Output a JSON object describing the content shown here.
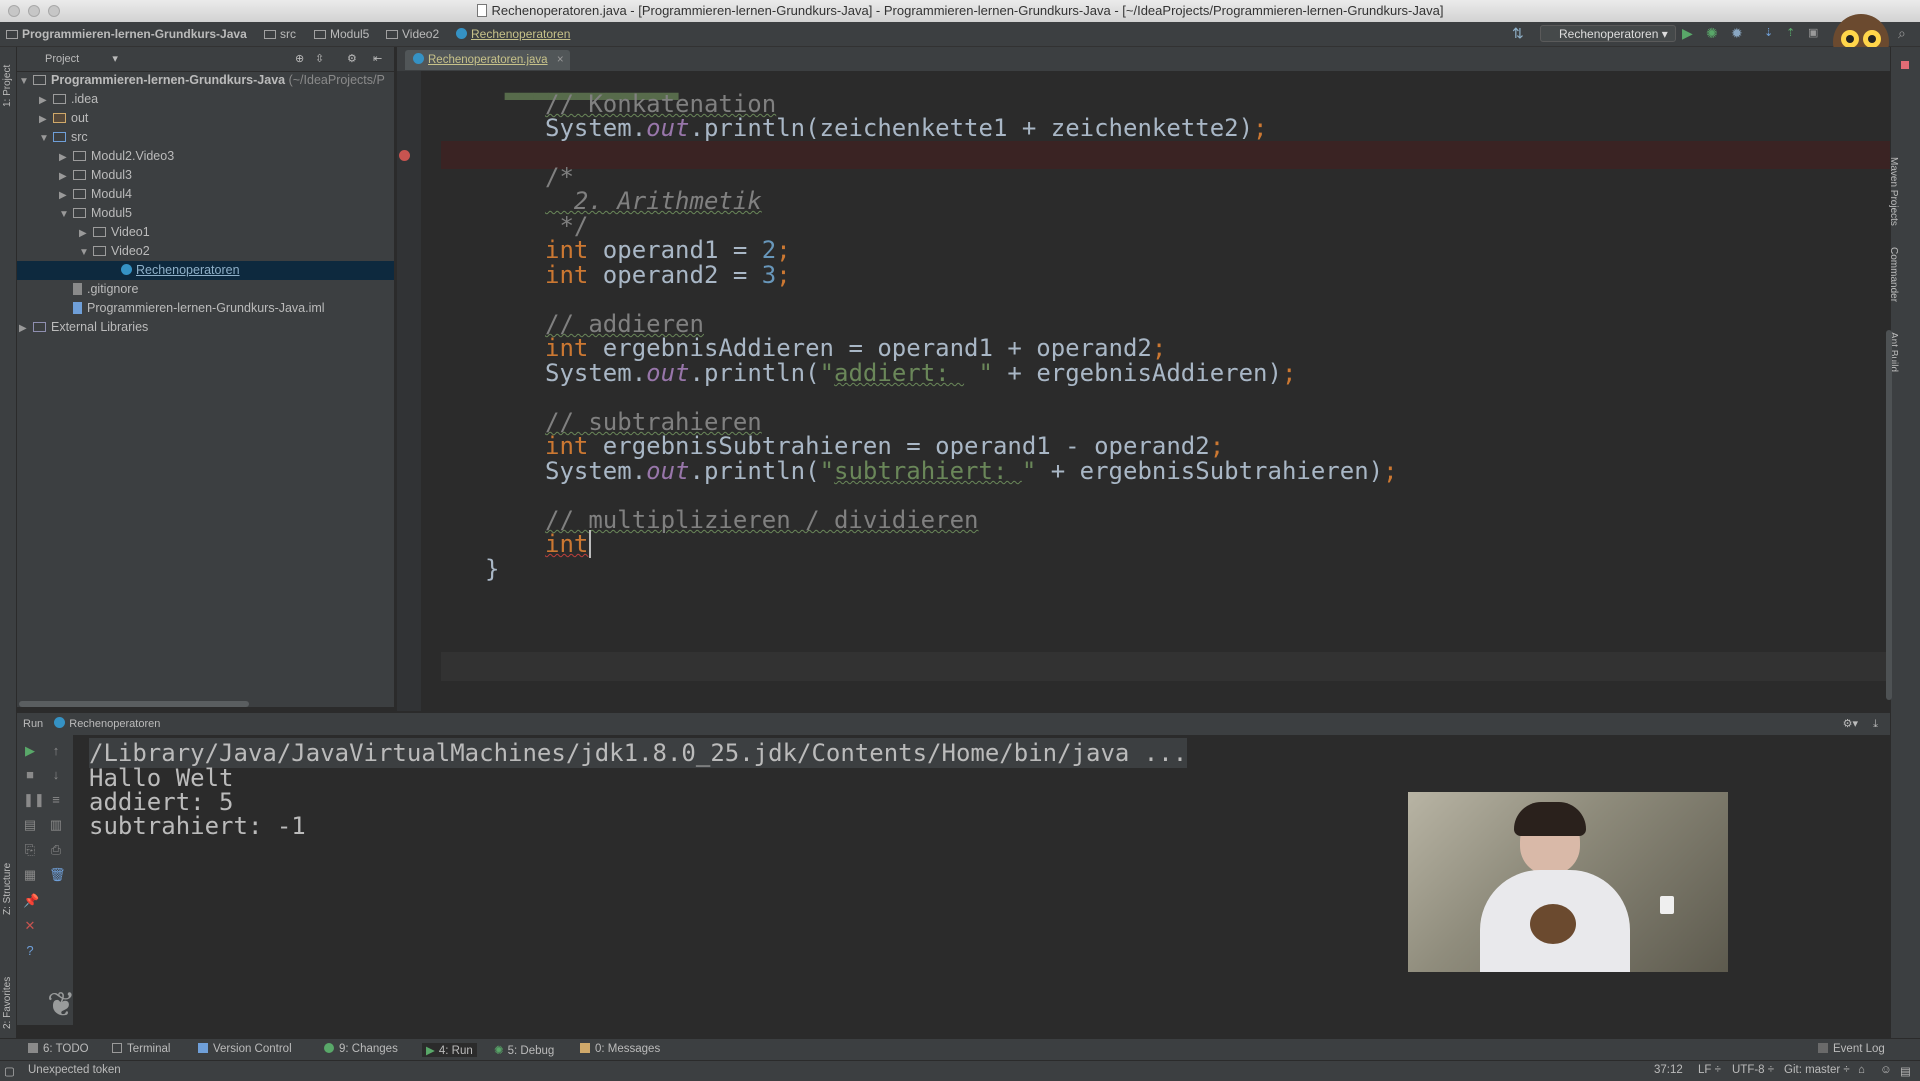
{
  "window": {
    "title": "Rechenoperatoren.java - [Programmieren-lernen-Grundkurs-Java] - Programmieren-lernen-Grundkurs-Java - [~/IdeaProjects/Programmieren-lernen-Grundkurs-Java]"
  },
  "navbar": {
    "crumbs": [
      "Programmieren-lernen-Grundkurs-Java",
      "src",
      "Modul5",
      "Video2",
      "Rechenoperatoren"
    ],
    "run_config": "Rechenoperatoren"
  },
  "side_tabs": {
    "left_top": "1: Project",
    "left_structure": "Z: Structure",
    "left_favorites": "2: Favorites",
    "right_maven": "Maven Projects",
    "right_commander": "Commander",
    "right_ant": "Ant Build"
  },
  "project": {
    "header": "Project",
    "tree": [
      {
        "label": "Programmieren-lernen-Grundkurs-Java",
        "suffix": "(~/IdeaProjects/P",
        "arrow": "▼"
      },
      {
        "label": ".idea",
        "arrow": "▶"
      },
      {
        "label": "out",
        "arrow": "▶"
      },
      {
        "label": "src",
        "arrow": "▼"
      },
      {
        "label": "Modul2.Video3",
        "arrow": "▶"
      },
      {
        "label": "Modul3",
        "arrow": "▶"
      },
      {
        "label": "Modul4",
        "arrow": "▶"
      },
      {
        "label": "Modul5",
        "arrow": "▼"
      },
      {
        "label": "Video1",
        "arrow": "▶"
      },
      {
        "label": "Video2",
        "arrow": "▼"
      },
      {
        "label": "Rechenoperatoren",
        "arrow": ""
      },
      {
        "label": ".gitignore",
        "arrow": ""
      },
      {
        "label": "Programmieren-lernen-Grundkurs-Java.iml",
        "arrow": ""
      },
      {
        "label": "External Libraries",
        "arrow": "▶"
      }
    ]
  },
  "editor": {
    "tab": "Rechenoperatoren.java",
    "lines": {
      "c_konkat": "// Konkatenation",
      "print1_a": "System.",
      "print1_b": "out",
      "print1_c": ".println(zeichenkette1 + zeichenkette2)",
      "semi": ";",
      "block_open": "/*",
      "block_mid": "  2. Arithmetik",
      "block_close": " */",
      "kw_int": "int",
      "decl1": " operand1 = ",
      "val1": "2",
      "decl2": " operand2 = ",
      "val2": "3",
      "c_add": "// addieren",
      "add_decl": " ergebnisAddieren = operand1 + operand2",
      "print_paren": ".println(",
      "q": "\"",
      "str_add": "addiert: ",
      "str_add_end": " \"",
      "print_add_rest": " + ergebnisAddieren)",
      "c_sub": "// subtrahieren",
      "sub_decl": " ergebnisSubtrahieren = operand1 - operand2",
      "str_sub": "subtrahiert: ",
      "print_sub_rest": " + ergebnisSubtrahieren)",
      "c_mul": "// multiplizieren / dividieren",
      "brace": "}"
    }
  },
  "run": {
    "label": "Run",
    "config": "Rechenoperatoren",
    "console": [
      "/Library/Java/JavaVirtualMachines/jdk1.8.0_25.jdk/Contents/Home/bin/java ...",
      "Hallo Welt",
      "addiert: 5",
      "subtrahiert: -1"
    ]
  },
  "toolwindows": {
    "todo": "6: TODO",
    "terminal": "Terminal",
    "vcs": "Version Control",
    "changes": "9: Changes",
    "run": "4: Run",
    "debug": "5: Debug",
    "messages": "0: Messages",
    "eventlog": "Event Log"
  },
  "status": {
    "message": "Unexpected token",
    "position": "37:12",
    "line_sep": "LF ÷",
    "encoding": "UTF-8 ÷",
    "git": "Git: master ÷"
  },
  "colors": {
    "keyword": "#cc7832",
    "number": "#6897bb",
    "string": "#6a8759",
    "comment": "#808080",
    "field": "#9876aa",
    "breakpoint": "#c75450"
  }
}
